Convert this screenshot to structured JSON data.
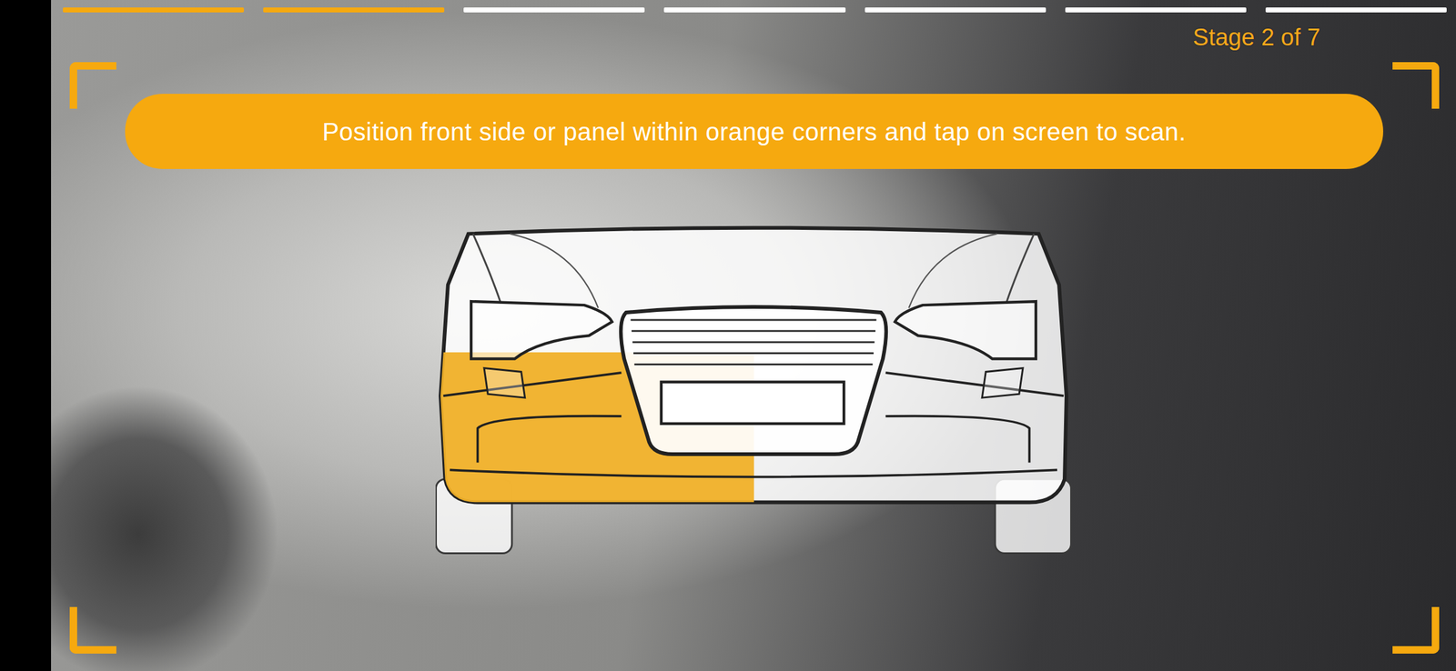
{
  "progress": {
    "segments": [
      {
        "completed": true
      },
      {
        "completed": true
      },
      {
        "completed": false
      },
      {
        "completed": false
      },
      {
        "completed": false
      },
      {
        "completed": false
      },
      {
        "completed": false
      }
    ]
  },
  "stage_label": "Stage 2 of 7",
  "instruction": "Position front side or panel within orange corners and tap on screen to scan.",
  "diagram": {
    "panels": [
      {
        "side": "left",
        "selected": true
      },
      {
        "side": "right",
        "selected": false
      }
    ]
  }
}
